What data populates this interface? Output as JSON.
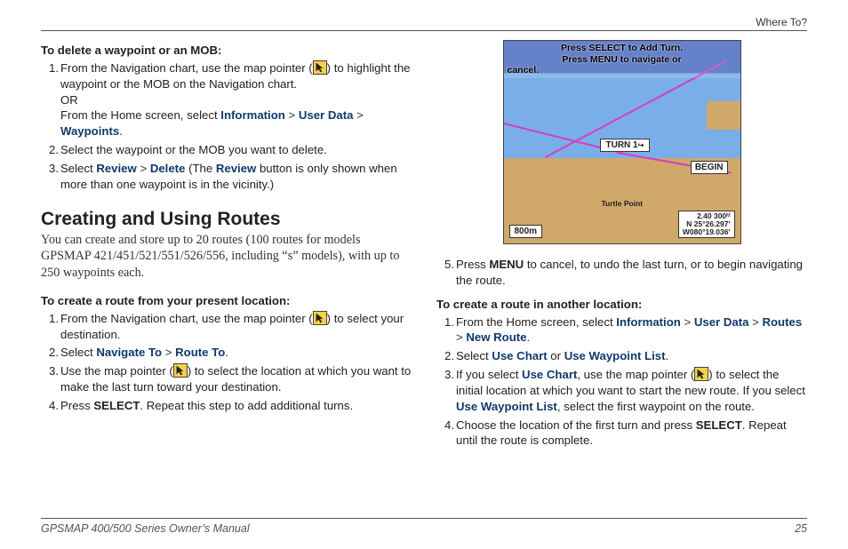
{
  "header": {
    "section": "Where To?"
  },
  "left": {
    "task1_head": "To delete a waypoint or an MOB:",
    "t1s1a": "From the Navigation chart, use the map pointer (",
    "t1s1b": ") to highlight the waypoint or the MOB on the Navigation chart.",
    "t1s1_or": "OR",
    "t1s1c": "From the Home screen, select ",
    "kw_info": "Information",
    "kw_userdata": "User Data",
    "kw_waypoints": "Waypoints",
    "t1s2": "Select the waypoint or the MOB you want to delete.",
    "t1s3a": "Select ",
    "kw_review": "Review",
    "kw_delete": "Delete",
    "t1s3b": " (The ",
    "t1s3c": " button is only shown when more than one waypoint is in the vicinity.)",
    "h2": "Creating and Using Routes",
    "intro": "You can create and store up to 20 routes (100 routes for models GPSMAP 421/451/521/551/526/556, including “s” models), with up to 250 waypoints each.",
    "task2_head": "To create a route from your present location:",
    "t2s1a": "From the Navigation chart, use the map pointer (",
    "t2s1b": ") to select your destination.",
    "t2s2a": "Select ",
    "kw_navto": "Navigate To",
    "kw_routeto": "Route To",
    "t2s3a": "Use the map pointer (",
    "t2s3b": ") to select the location at which you want to make the last turn toward your destination.",
    "t2s4a": "Press ",
    "kw_select": "SELECT",
    "t2s4b": ". Repeat this step to add additional turns."
  },
  "right": {
    "map": {
      "banner_l1": "Press SELECT to Add Turn.",
      "banner_l2": "Press MENU to navigate or",
      "banner_l3": "cancel.",
      "turn": "TURN 1",
      "begin": "BEGIN",
      "scale": "800m",
      "coord_l1": "2.40 300",
      "coord_l2": "N 25°26.297'",
      "coord_l3": "W080°19.036'",
      "turtle": "Turtle Point"
    },
    "s5a": "Press ",
    "kw_menu": "MENU",
    "s5b": " to cancel, to undo the last turn, or to begin navigating the route.",
    "task3_head": "To create a route in another location:",
    "t3s1a": "From the Home screen, select ",
    "kw_info": "Information",
    "kw_userdata": "User Data",
    "kw_routes": "Routes",
    "kw_newroute": "New Route",
    "t3s2a": "Select ",
    "kw_usechart": "Use Chart",
    "or": " or ",
    "kw_usewpl": "Use Waypoint List",
    "t3s3a": "If you select ",
    "t3s3b": ", use the map pointer (",
    "t3s3c": ") to select the initial location at which you want to start the new route. If you select ",
    "t3s3d": ", select the first waypoint on the route.",
    "t3s4a": "Choose the location of the first turn and press ",
    "kw_select": "SELECT",
    "t3s4b": ". Repeat until the route is complete."
  },
  "footer": {
    "book": "GPSMAP 400/500 Series Owner’s Manual",
    "page": "25"
  }
}
